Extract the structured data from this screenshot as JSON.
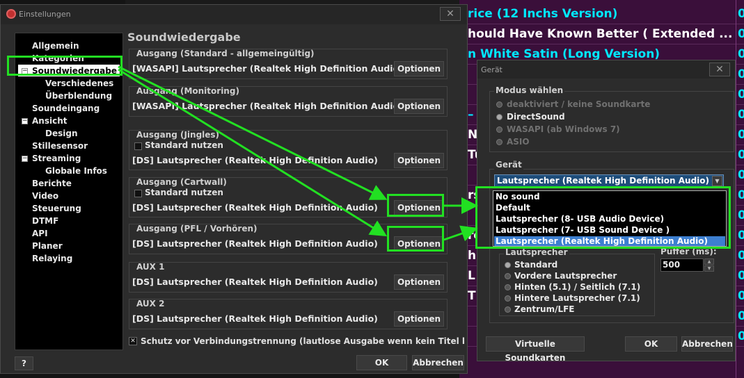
{
  "background_playlist": {
    "rows": [
      {
        "text": "rice (12 Inchs  Version)",
        "white": false
      },
      {
        "text": "hould Have Known Better ( Extended ...",
        "white": true
      },
      {
        "text": "n White Satin (Long  Version)",
        "white": false
      },
      {
        "text": "",
        "white": false
      },
      {
        "text": "",
        "white": false
      },
      {
        "text": "–",
        "white": false
      },
      {
        "text": "N",
        "white": true
      },
      {
        "text": "Tu",
        "white": true
      },
      {
        "text": "",
        "white": false
      },
      {
        "text": "rs",
        "white": true
      },
      {
        "text": "",
        "white": false
      },
      {
        "text": "re",
        "white": true
      },
      {
        "text": "h",
        "white": true
      },
      {
        "text": "L",
        "white": true
      },
      {
        "text": "Th",
        "white": true
      },
      {
        "text": "",
        "white": false
      },
      {
        "text": "",
        "white": false
      }
    ],
    "col_marks": [
      "0",
      "0",
      "0",
      "0",
      "0",
      "0",
      "0",
      "0",
      "0",
      "0",
      "0",
      "0",
      "0",
      "0",
      "0",
      "0",
      "0"
    ]
  },
  "settings": {
    "title": "Einstellungen",
    "close": "✕",
    "nav": [
      {
        "label": "Allgemein",
        "indent": 0,
        "exp": ""
      },
      {
        "label": "Kategorien",
        "indent": 0,
        "exp": ""
      },
      {
        "label": "Soundwiedergabe",
        "indent": 0,
        "exp": "−",
        "selected": true
      },
      {
        "label": "Verschiedenes",
        "indent": 1,
        "exp": ""
      },
      {
        "label": "Überblendung",
        "indent": 1,
        "exp": ""
      },
      {
        "label": "Soundeingang",
        "indent": 0,
        "exp": ""
      },
      {
        "label": "Ansicht",
        "indent": 0,
        "exp": "−"
      },
      {
        "label": "Design",
        "indent": 1,
        "exp": ""
      },
      {
        "label": "Stillesensor",
        "indent": 0,
        "exp": ""
      },
      {
        "label": "Streaming",
        "indent": 0,
        "exp": "−"
      },
      {
        "label": "Globale Infos",
        "indent": 1,
        "exp": ""
      },
      {
        "label": "Berichte",
        "indent": 0,
        "exp": ""
      },
      {
        "label": "Video",
        "indent": 0,
        "exp": ""
      },
      {
        "label": "Steuerung",
        "indent": 0,
        "exp": ""
      },
      {
        "label": "DTMF",
        "indent": 0,
        "exp": ""
      },
      {
        "label": "API",
        "indent": 0,
        "exp": ""
      },
      {
        "label": "Planer",
        "indent": 0,
        "exp": ""
      },
      {
        "label": "Relaying",
        "indent": 0,
        "exp": ""
      }
    ],
    "section_title": "Soundwiedergabe",
    "groups": [
      {
        "title": "Ausgang (Standard - allgemeingültig)",
        "device": "[WASAPI] Lautsprecher (Realtek High Definition Audio)",
        "button": "Optionen"
      },
      {
        "title": "Ausgang (Monitoring)",
        "device": "[WASAPI] Lautsprecher (Realtek High Definition Audio)",
        "button": "Optionen"
      },
      {
        "title": "Ausgang (Jingles)",
        "checkbox": "Standard nutzen",
        "device": "[DS] Lautsprecher (Realtek High Definition Audio)",
        "button": "Optionen"
      },
      {
        "title": "Ausgang (Cartwall)",
        "checkbox": "Standard nutzen",
        "device": "[DS] Lautsprecher (Realtek High Definition Audio)",
        "button": "Optionen"
      },
      {
        "title": "Ausgang (PFL / Vorhören)",
        "device": "[DS] Lautsprecher (Realtek High Definition Audio)",
        "button": "Optionen"
      },
      {
        "title": "AUX 1",
        "device": "[DS] Lautsprecher (Realtek High Definition Audio)",
        "button": "Optionen"
      },
      {
        "title": "AUX 2",
        "device": "[DS] Lautsprecher (Realtek High Definition Audio)",
        "button": "Optionen"
      }
    ],
    "protect_check_mark": "✕",
    "protect_label": "Schutz vor Verbindungstrennung (lautlose Ausgabe wenn kein Titel l",
    "help": "?",
    "ok": "OK",
    "cancel": "Abbrechen"
  },
  "device_dialog": {
    "title": "Gerät",
    "close": "✕",
    "mode_title": "Modus wählen",
    "modes": [
      {
        "label": "deaktiviert / keine Soundkarte",
        "disabled": true,
        "on": false
      },
      {
        "label": "DirectSound",
        "disabled": false,
        "on": true
      },
      {
        "label": "WASAPI (ab Windows 7)",
        "disabled": true,
        "on": false
      },
      {
        "label": "ASIO",
        "disabled": true,
        "on": false
      }
    ],
    "device_title": "Gerät",
    "combo_value": "Lautsprecher (Realtek High Definition Audio)",
    "combo_arrow": "▼",
    "dropdown_options": [
      "No sound",
      "Default",
      "Lautsprecher (8- USB Audio Device)",
      "Lautsprecher (7- USB Sound Device        )",
      "Lautsprecher (Realtek High Definition Audio)"
    ],
    "dropdown_selected_index": 4,
    "speaker_title": "Lautsprecher",
    "speakers": [
      {
        "label": "Standard",
        "on": true
      },
      {
        "label": "Vordere Lautsprecher",
        "on": false
      },
      {
        "label": "Hinten (5.1) / Seitlich (7.1)",
        "on": false
      },
      {
        "label": "Hintere Lautsprecher (7.1)",
        "on": false
      },
      {
        "label": "Zentrum/LFE",
        "on": false
      }
    ],
    "buffer_title": "Puffer (ms):",
    "buffer_value": "500",
    "spin_up": "▲",
    "spin_down": "▼",
    "virtual_button": "Virtuelle Soundkarten",
    "ok": "OK",
    "cancel": "Abbrechen"
  },
  "annotation_color": "#22e022"
}
